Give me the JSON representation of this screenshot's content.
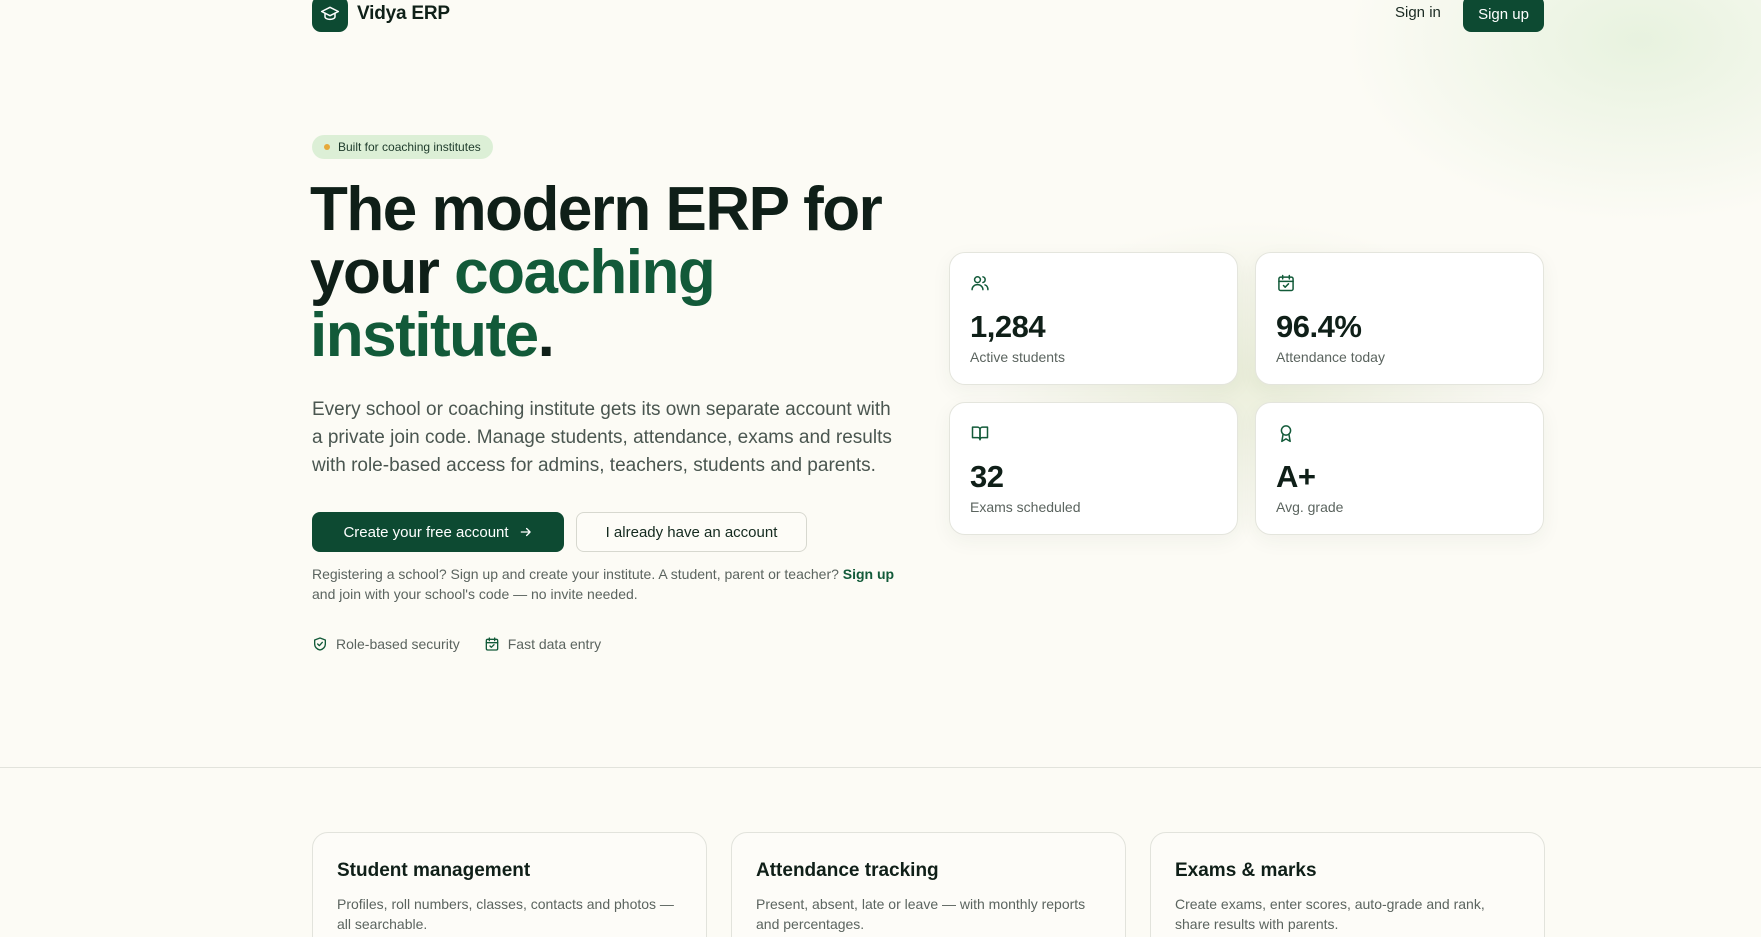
{
  "header": {
    "brand_name": "Vidya ERP",
    "signin_label": "Sign in",
    "signup_label": "Sign up"
  },
  "hero": {
    "pill_label": "Built for coaching institutes",
    "headline_line1": "The modern ERP for",
    "headline_line2_plain": "your ",
    "headline_line2_accent": "coaching",
    "headline_line3_accent": "institute",
    "headline_period": ".",
    "lead": "Every school or coaching institute gets its own separate account with a private join code. Manage students, attendance, exams and results with role-based access for admins, teachers, students and parents.",
    "primary_cta": "Create your free account",
    "secondary_cta": "I already have an account",
    "note_prefix": "Registering a school? Sign up and create your institute. A student, parent or teacher? ",
    "note_link": "Sign up",
    "note_suffix": " and join with your school's code — no invite needed.",
    "badges": [
      {
        "icon": "shield-check-icon",
        "label": "Role-based security"
      },
      {
        "icon": "calendar-check-icon",
        "label": "Fast data entry"
      }
    ]
  },
  "stats": [
    {
      "icon": "users-icon",
      "value": "1,284",
      "label": "Active students"
    },
    {
      "icon": "calendar-check-icon",
      "value": "96.4%",
      "label": "Attendance today"
    },
    {
      "icon": "open-book-icon",
      "value": "32",
      "label": "Exams scheduled"
    },
    {
      "icon": "award-icon",
      "value": "A+",
      "label": "Avg. grade"
    }
  ],
  "features": [
    {
      "title": "Student management",
      "description": "Profiles, roll numbers, classes, contacts and photos — all searchable."
    },
    {
      "title": "Attendance tracking",
      "description": "Present, absent, late or leave — with monthly reports and percentages."
    },
    {
      "title": "Exams & marks",
      "description": "Create exams, enter scores, auto-grade and rank, share results with parents."
    }
  ],
  "colors": {
    "brand": "#0d4a32",
    "accent_text": "#125a39",
    "background": "#fcfbf5",
    "pill_bg": "#dcefd6",
    "pill_dot": "#e6a93a"
  }
}
